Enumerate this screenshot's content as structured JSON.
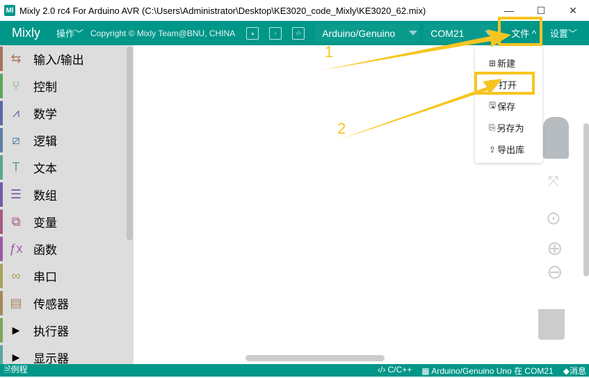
{
  "window": {
    "title": "Mixly 2.0 rc4 For Arduino AVR (C:\\Users\\Administrator\\Desktop\\KE3020_code_Mixly\\KE3020_62.mix)",
    "app_icon": "Ml",
    "minimize": "—",
    "maximize": "☐",
    "close": "✕"
  },
  "toolbar": {
    "logo": "Mixly",
    "operate": "操作﹀",
    "copyright": "Copyright © Mixly Team@BNU, CHINA",
    "board": "Arduino/Genuino",
    "port": "COM21",
    "file": "文件 ^",
    "settings": "设置﹀"
  },
  "sidebar": {
    "items": [
      {
        "label": "输入/输出",
        "icon": "⇆",
        "color": "#a5745b"
      },
      {
        "label": "控制",
        "icon": "⑂",
        "color": "#5ba55b"
      },
      {
        "label": "数学",
        "icon": "⩘",
        "color": "#5b67a5"
      },
      {
        "label": "逻辑",
        "icon": "⧄",
        "color": "#5b80a5"
      },
      {
        "label": "文本",
        "icon": "T",
        "color": "#5ba58c"
      },
      {
        "label": "数组",
        "icon": "☰",
        "color": "#745ba5"
      },
      {
        "label": "变量",
        "icon": "⧉",
        "color": "#a55b80"
      },
      {
        "label": "函数",
        "icon": "ƒx",
        "color": "#995ba5"
      },
      {
        "label": "串口",
        "icon": "∞",
        "color": "#a5a55b"
      },
      {
        "label": "传感器",
        "icon": "▤",
        "color": "#a5875b"
      },
      {
        "label": "执行器",
        "icon": "▶",
        "color": "#7ba55b"
      },
      {
        "label": "显示器",
        "icon": "▶",
        "color": "#5ba5a5"
      }
    ]
  },
  "file_menu": {
    "items": [
      {
        "label": "新建",
        "icon": "⊞"
      },
      {
        "label": "打开",
        "icon": "🗀"
      },
      {
        "label": "保存",
        "icon": "🖫"
      },
      {
        "label": "另存为",
        "icon": "⎘"
      },
      {
        "label": "导出库",
        "icon": "⇪"
      }
    ]
  },
  "statusbar": {
    "examples": "🗎例程",
    "lang": "‹/› C/C++",
    "board_status": "▦ Arduino/Genuino Uno 在 COM21",
    "messages": "◆消息"
  },
  "annotations": {
    "step1": "1",
    "step2": "2",
    "color": "#f7c520"
  }
}
